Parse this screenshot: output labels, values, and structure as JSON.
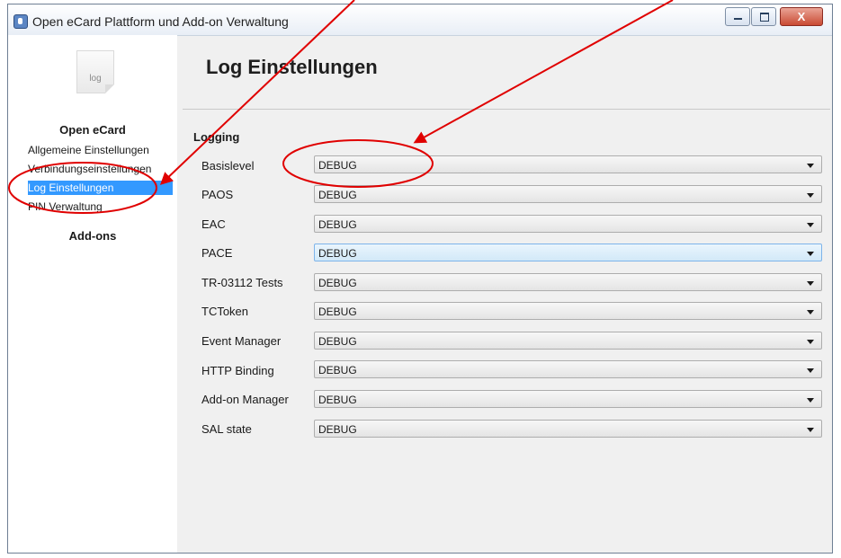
{
  "window": {
    "title": "Open eCard Plattform und Add-on Verwaltung",
    "close_glyph": "X"
  },
  "sidebar": {
    "icon_label": "log",
    "section_title": "Open eCard",
    "items": [
      {
        "label": "Allgemeine Einstellungen"
      },
      {
        "label": "Verbindungseinstellungen"
      },
      {
        "label": "Log Einstellungen",
        "selected": true
      },
      {
        "label": "PIN Verwaltung"
      }
    ],
    "addons_title": "Add-ons"
  },
  "main": {
    "title": "Log Einstellungen",
    "group_title": "Logging",
    "rows": [
      {
        "label": "Basislevel",
        "value": "DEBUG"
      },
      {
        "label": "PAOS",
        "value": "DEBUG"
      },
      {
        "label": "EAC",
        "value": "DEBUG"
      },
      {
        "label": "PACE",
        "value": "DEBUG"
      },
      {
        "label": "TR-03112 Tests",
        "value": "DEBUG"
      },
      {
        "label": "TCToken",
        "value": "DEBUG"
      },
      {
        "label": "Event Manager",
        "value": "DEBUG"
      },
      {
        "label": "HTTP Binding",
        "value": "DEBUG"
      },
      {
        "label": "Add-on Manager",
        "value": "DEBUG"
      },
      {
        "label": "SAL state",
        "value": "DEBUG"
      }
    ]
  },
  "colors": {
    "selection": "#3399ff",
    "annotation": "#e00000"
  }
}
